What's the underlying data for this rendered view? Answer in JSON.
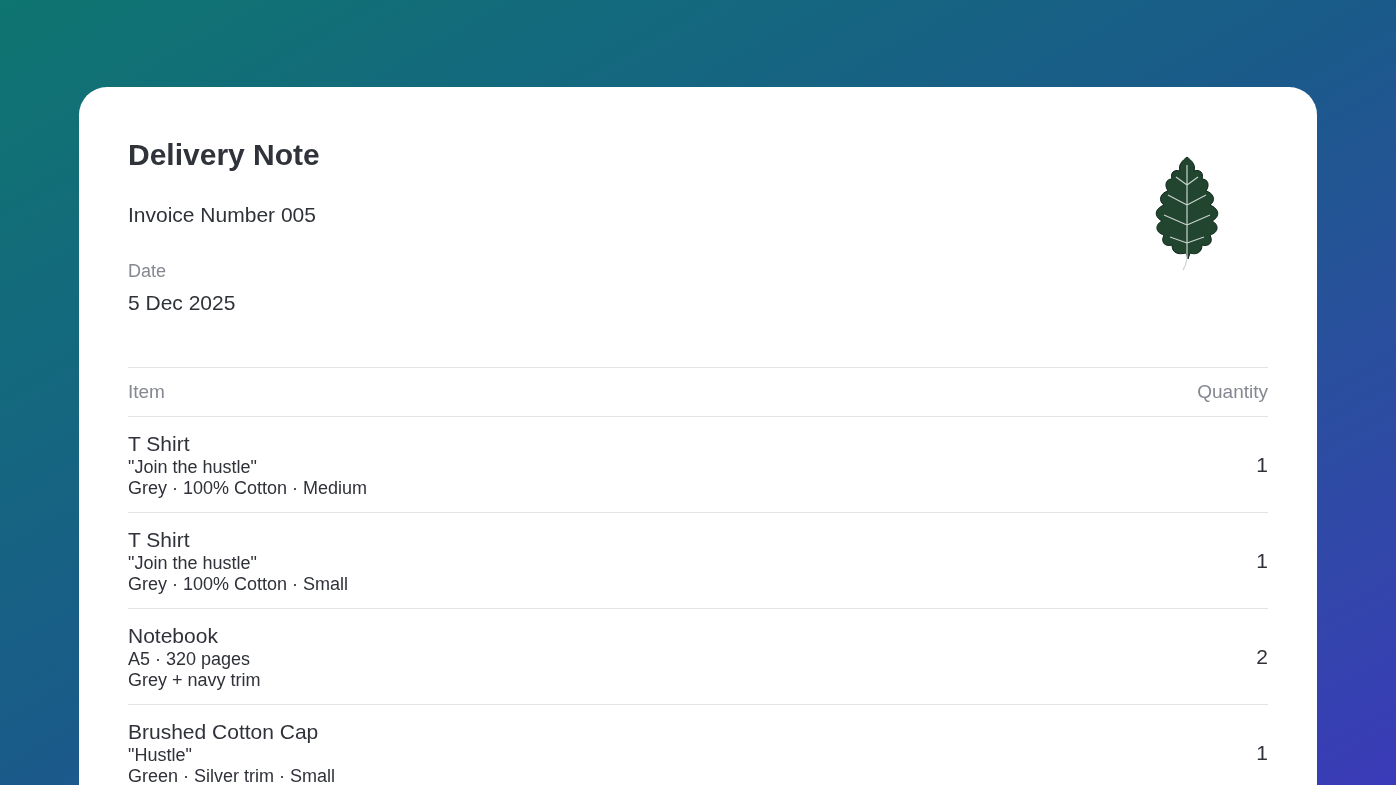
{
  "document": {
    "title": "Delivery Note",
    "invoice_number": "Invoice Number 005",
    "date_label": "Date",
    "date": "5 Dec 2025"
  },
  "table": {
    "columns": [
      "Item",
      "Quantity"
    ],
    "rows": [
      {
        "name": "T Shirt",
        "details": [
          "\"Join the hustle\"",
          "Grey · 100% Cotton · Medium"
        ],
        "quantity": "1"
      },
      {
        "name": "T Shirt",
        "details": [
          "\"Join the hustle\"",
          "Grey · 100% Cotton · Small"
        ],
        "quantity": "1"
      },
      {
        "name": "Notebook",
        "details": [
          "A5 · 320 pages",
          "Grey + navy trim"
        ],
        "quantity": "2"
      },
      {
        "name": "Brushed Cotton Cap",
        "details": [
          "\"Hustle\"",
          "Green · Silver trim · Small"
        ],
        "quantity": "1"
      }
    ]
  }
}
